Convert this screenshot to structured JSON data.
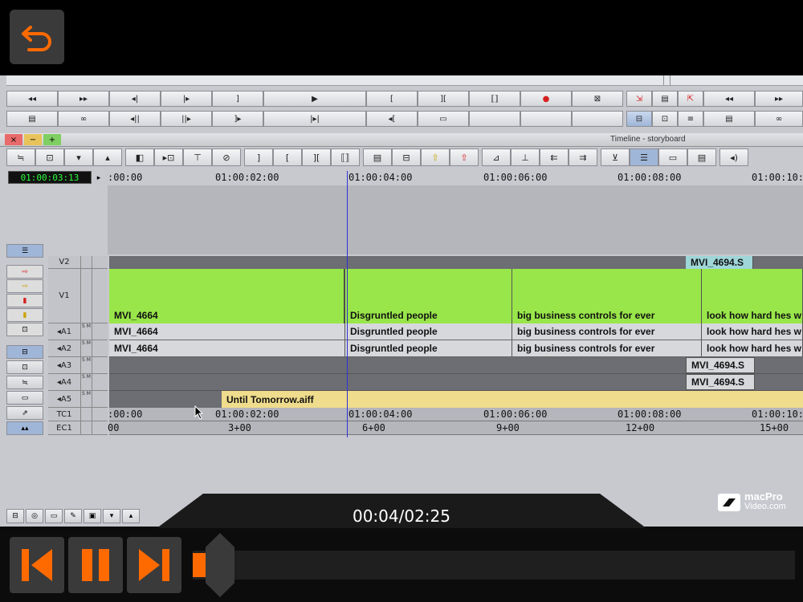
{
  "player": {
    "back_icon": "back-arrow-icon",
    "time_readout": "00:04/02:25",
    "progress": 0.0276,
    "accent": "#ff6a00",
    "logo_line1": "macPro",
    "logo_line2": "Video.com"
  },
  "window": {
    "title": "Timeline - storyboard",
    "close": "×",
    "minimize": "−",
    "zoom": "+"
  },
  "timecode": {
    "display": "01:00:03:13"
  },
  "ruler": {
    "top_labels": [
      ":00:00",
      "01:00:02:00",
      "01:00:04:00",
      "01:00:06:00",
      "01:00:08:00",
      "01:00:10:"
    ],
    "tc1_labels": [
      ":00:00",
      "01:00:02:00",
      "01:00:04:00",
      "01:00:06:00",
      "01:00:08:00",
      "01:00:10:"
    ],
    "ec1_labels": [
      "00",
      "3+00",
      "6+00",
      "9+00",
      "12+00",
      "15+00"
    ]
  },
  "tracks": {
    "labels": [
      "V2",
      "V1",
      "◂A1",
      "◂A2",
      "◂A3",
      "◂A4",
      "◂A5",
      "TC1",
      "EC1"
    ],
    "sm": "S M"
  },
  "clips": {
    "v2": "MVI_4694.S",
    "v1": [
      "MVI_4664",
      "Disgruntled people",
      "big business controls for ever",
      "look how hard hes w"
    ],
    "a1": [
      "MVI_4664",
      "Disgruntled people",
      "big business controls for ever",
      "look how hard hes w"
    ],
    "a2": [
      "MVI_4664",
      "Disgruntled people",
      "big business controls for ever",
      "look how hard hes w"
    ],
    "a3": "MVI_4694.S",
    "a4": "MVI_4694.S",
    "a5": "Until Tomorrow.aiff"
  }
}
